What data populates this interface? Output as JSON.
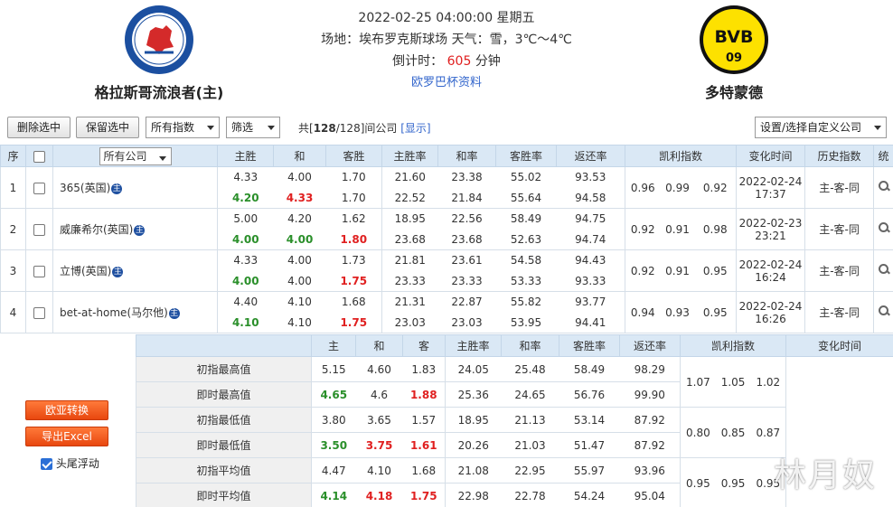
{
  "match": {
    "home_team": "格拉斯哥流浪者(主)",
    "away_team": "多特蒙德",
    "datetime": "2022-02-25 04:00:00 星期五",
    "venue_weather": "场地：埃布罗克斯球场 天气：雪，3℃～4℃",
    "countdown_label": "倒计时：",
    "countdown_value": "605",
    "countdown_unit": "分钟",
    "link": "欧罗巴杯资料"
  },
  "toolbar": {
    "delete_selected": "删除选中",
    "keep_selected": "保留选中",
    "index_filter": "所有指数",
    "filter": "筛选",
    "total_prefix": "共[",
    "total_shown": "128",
    "total_mid": "/128]间公司",
    "show_link": "[显示]",
    "settings": "设置/选择自定义公司"
  },
  "table": {
    "headers": {
      "seq": "序",
      "company": "所有公司",
      "home_win": "主胜",
      "draw": "和",
      "away_win": "客胜",
      "home_rate": "主胜率",
      "draw_rate": "和率",
      "away_rate": "客胜率",
      "return_rate": "返还率",
      "kelly": "凯利指数",
      "change_time": "变化时间",
      "history": "历史指数",
      "stats": "统"
    },
    "rows": [
      {
        "seq": "1",
        "company": "365(英国)",
        "badge": "主",
        "o1": [
          "4.33",
          "4.00",
          "1.70"
        ],
        "o1c": [
          "",
          "",
          ""
        ],
        "o2": [
          "4.20",
          "4.33",
          "1.70"
        ],
        "o2c": [
          "g",
          "r",
          ""
        ],
        "p1": [
          "21.60",
          "23.38",
          "55.02",
          "93.53"
        ],
        "p2": [
          "22.52",
          "21.84",
          "55.64",
          "94.58"
        ],
        "kelly": [
          "0.96",
          "0.99",
          "0.92"
        ],
        "date": "2022-02-24",
        "time": "17:37",
        "hist": "主-客-同"
      },
      {
        "seq": "2",
        "company": "威廉希尔(英国)",
        "badge": "主",
        "o1": [
          "5.00",
          "4.20",
          "1.62"
        ],
        "o1c": [
          "",
          "",
          ""
        ],
        "o2": [
          "4.00",
          "4.00",
          "1.80"
        ],
        "o2c": [
          "g",
          "g",
          "r"
        ],
        "p1": [
          "18.95",
          "22.56",
          "58.49",
          "94.75"
        ],
        "p2": [
          "23.68",
          "23.68",
          "52.63",
          "94.74"
        ],
        "kelly": [
          "0.92",
          "0.91",
          "0.98"
        ],
        "date": "2022-02-23",
        "time": "23:21",
        "hist": "主-客-同"
      },
      {
        "seq": "3",
        "company": "立博(英国)",
        "badge": "主",
        "o1": [
          "4.33",
          "4.00",
          "1.73"
        ],
        "o1c": [
          "",
          "",
          ""
        ],
        "o2": [
          "4.00",
          "4.00",
          "1.75"
        ],
        "o2c": [
          "g",
          "",
          "r"
        ],
        "p1": [
          "21.81",
          "23.61",
          "54.58",
          "94.43"
        ],
        "p2": [
          "23.33",
          "23.33",
          "53.33",
          "93.33"
        ],
        "kelly": [
          "0.92",
          "0.91",
          "0.95"
        ],
        "date": "2022-02-24",
        "time": "16:24",
        "hist": "主-客-同"
      },
      {
        "seq": "4",
        "company": "bet-at-home(马尔他)",
        "badge": "主",
        "o1": [
          "4.40",
          "4.10",
          "1.68"
        ],
        "o1c": [
          "",
          "",
          ""
        ],
        "o2": [
          "4.10",
          "4.10",
          "1.75"
        ],
        "o2c": [
          "g",
          "",
          "r"
        ],
        "p1": [
          "21.31",
          "22.87",
          "55.82",
          "93.77"
        ],
        "p2": [
          "23.03",
          "23.03",
          "53.95",
          "94.41"
        ],
        "kelly": [
          "0.94",
          "0.93",
          "0.95"
        ],
        "date": "2022-02-24",
        "time": "16:26",
        "hist": "主-客-同"
      }
    ]
  },
  "side": {
    "convert_button": "欧亚转换",
    "export_button": "导出Excel",
    "float_label": "头尾浮动"
  },
  "stats": {
    "headers": {
      "home": "主",
      "draw": "和",
      "away": "客",
      "home_rate": "主胜率",
      "draw_rate": "和率",
      "away_rate": "客胜率",
      "return_rate": "返还率",
      "kelly": "凯利指数",
      "change_time": "变化时间"
    },
    "rows": [
      {
        "label": "初指最高值",
        "v": [
          "5.15",
          "4.60",
          "1.83"
        ],
        "c": [
          "",
          "",
          ""
        ],
        "p": [
          "24.05",
          "25.48",
          "58.49",
          "98.29"
        ]
      },
      {
        "label": "即时最高值",
        "v": [
          "4.65",
          "4.6",
          "1.88"
        ],
        "c": [
          "g",
          "",
          "r"
        ],
        "p": [
          "25.36",
          "24.65",
          "56.76",
          "99.90"
        ]
      },
      {
        "label": "初指最低值",
        "v": [
          "3.80",
          "3.65",
          "1.57"
        ],
        "c": [
          "",
          "",
          ""
        ],
        "p": [
          "18.95",
          "21.13",
          "53.14",
          "87.92"
        ]
      },
      {
        "label": "即时最低值",
        "v": [
          "3.50",
          "3.75",
          "1.61"
        ],
        "c": [
          "g",
          "r",
          "r"
        ],
        "p": [
          "20.26",
          "21.03",
          "51.47",
          "87.92"
        ]
      },
      {
        "label": "初指平均值",
        "v": [
          "4.47",
          "4.10",
          "1.68"
        ],
        "c": [
          "",
          "",
          ""
        ],
        "p": [
          "21.08",
          "22.95",
          "55.97",
          "93.96"
        ]
      },
      {
        "label": "即时平均值",
        "v": [
          "4.14",
          "4.18",
          "1.75"
        ],
        "c": [
          "g",
          "r",
          "r"
        ],
        "p": [
          "22.98",
          "22.78",
          "54.24",
          "95.04"
        ]
      }
    ],
    "kelly": [
      [
        "1.07",
        "1.05",
        "1.02"
      ],
      [
        "0.80",
        "0.85",
        "0.87"
      ],
      [
        "0.95",
        "0.95",
        "0.95"
      ]
    ]
  },
  "watermark": "林月奴",
  "colors": {
    "header_bg": "#dae8f5",
    "green": "#2a8f2a",
    "red": "#e02020",
    "link": "#3366cc",
    "orange": "#e8470f"
  }
}
